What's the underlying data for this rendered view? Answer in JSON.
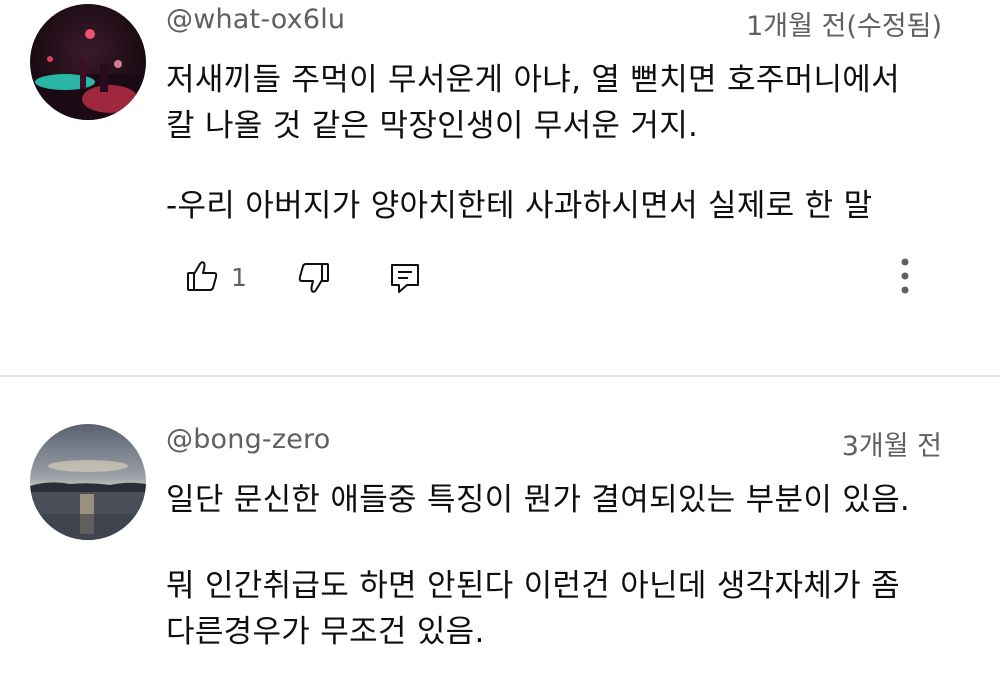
{
  "comments": [
    {
      "username": "@what-ox6lu",
      "timestamp": "1개월 전(수정됨)",
      "avatar_icon": "avatar-night-club-photo",
      "lines": [
        "저새끼들 주먹이 무서운게 아냐, 열 뻗치면 호주머니에서",
        "칼 나올 것 같은 막장인생이 무서운 거지.",
        "",
        "-우리 아버지가 양아치한테 사과하시면서 실제로 한 말"
      ],
      "like_count": "1"
    },
    {
      "username": "@bong-zero",
      "timestamp": "3개월 전",
      "avatar_icon": "avatar-lake-sunset-photo",
      "lines": [
        "일단 문신한 애들중 특징이 뭔가 결여되있는 부분이 있음.",
        "",
        "뭐 인간취급도 하면 안된다 이런건 아닌데 생각자체가 좀",
        "다른경우가 무조건 있음."
      ]
    }
  ],
  "icons": {
    "like": "thumbs-up-icon",
    "dislike": "thumbs-down-icon",
    "reply": "reply-icon",
    "more": "more-vertical-icon"
  },
  "colors": {
    "meta_text": "#606060",
    "body_text": "#0f0f0f",
    "divider": "#e5e5e5"
  }
}
